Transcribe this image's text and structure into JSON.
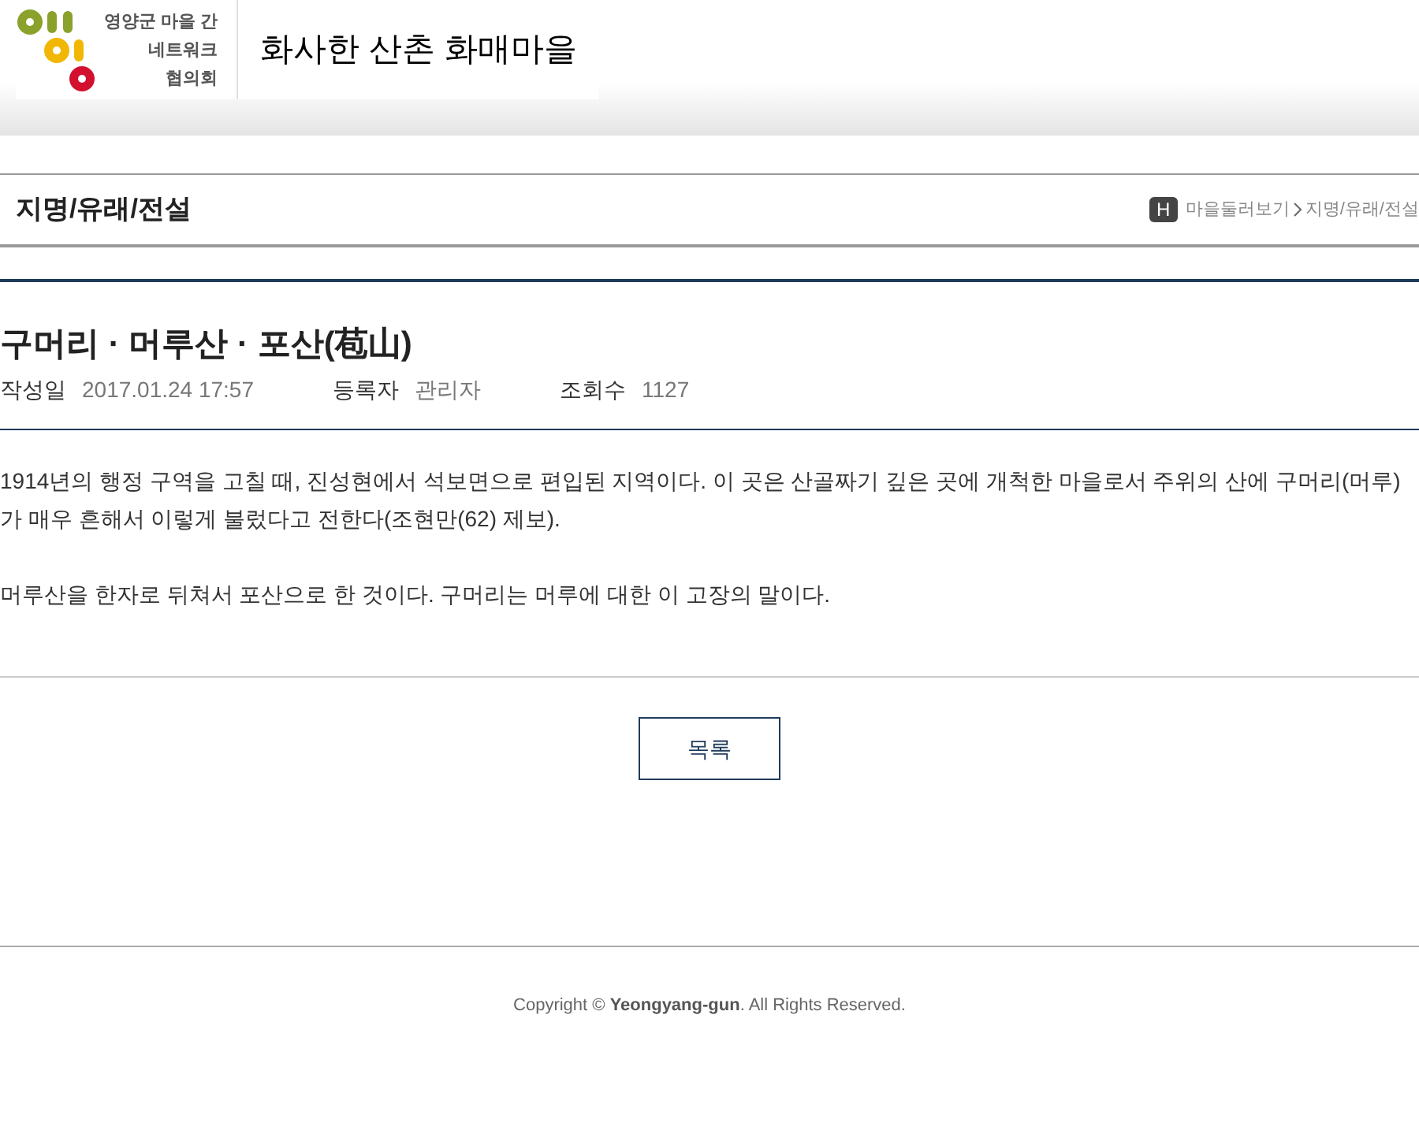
{
  "logo": {
    "lines": [
      "영양군 마을 간",
      "네트워크",
      "협의회"
    ]
  },
  "site_title": "화사한 산촌 화매마을",
  "page_heading": "지명/유래/전설",
  "breadcrumb": {
    "home": "H",
    "items": [
      "마을둘러보기",
      "지명/유래/전설"
    ]
  },
  "post": {
    "title": "구머리 · 머루산 · 포산(苞山)",
    "meta": [
      {
        "label": "작성일",
        "value": "2017.01.24 17:57"
      },
      {
        "label": "등록자",
        "value": "관리자"
      },
      {
        "label": "조회수",
        "value": "1127"
      }
    ],
    "paragraphs": [
      "1914년의 행정 구역을 고칠 때, 진성현에서 석보면으로 편입된 지역이다. 이 곳은 산골짜기 깊은 곳에 개척한 마을로서 주위의 산에 구머리(머루)가 매우 흔해서 이렇게 불렀다고 전한다(조현만(62) 제보).",
      "머루산을 한자로 뒤쳐서 포산으로 한 것이다. 구머리는 머루에 대한 이 고장의 말이다."
    ]
  },
  "list_button": "목록",
  "footer": "Copyright © **Yeongyang-gun**. All Rights Reserved."
}
